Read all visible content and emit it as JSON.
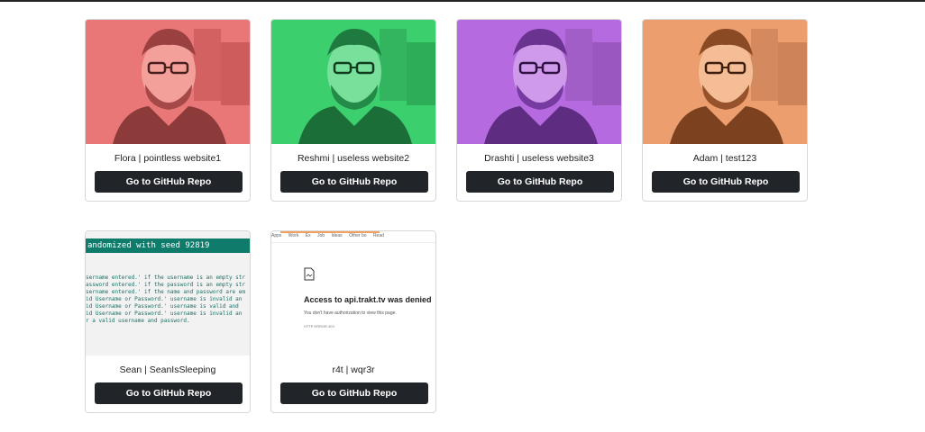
{
  "cards": [
    {
      "caption": "Flora | pointless website1",
      "button": "Go to GitHub Repo",
      "tint": "#f08080"
    },
    {
      "caption": "Reshmi | useless website2",
      "button": "Go to GitHub Repo",
      "tint": "#3ccf6e"
    },
    {
      "caption": "Drashti | useless website3",
      "button": "Go to GitHub Repo",
      "tint": "#b66ae0"
    },
    {
      "caption": "Adam | test123",
      "button": "Go to GitHub Repo",
      "tint": "#ec9e6e"
    },
    {
      "caption": "Sean | SeanIsSleeping",
      "button": "Go to GitHub Repo",
      "terminal": {
        "header": "andomized with seed 92819",
        "lines": [
          "sername entered.' if the username is an empty str",
          "assword entered.' if the password is an empty str",
          "sername entered.' if the name and password are em",
          "",
          "id Username or Password.' username is invalid an",
          "id Username or Password.' username is valid and",
          "id Username or Password.' username is invalid an",
          "",
          "r a valid username and password."
        ]
      }
    },
    {
      "caption": "r4t | wqr3r",
      "button": "Go to GitHub Repo",
      "browser_error": {
        "bookmarks": [
          "Apps",
          "Work",
          "Ex",
          "Job",
          "Ideas",
          "Other bo",
          "Read"
        ],
        "title": "Access to api.trakt.tv was denied",
        "subtitle": "You don't have authorization to view this page.",
        "code": "HTTP ERROR 403"
      }
    }
  ]
}
